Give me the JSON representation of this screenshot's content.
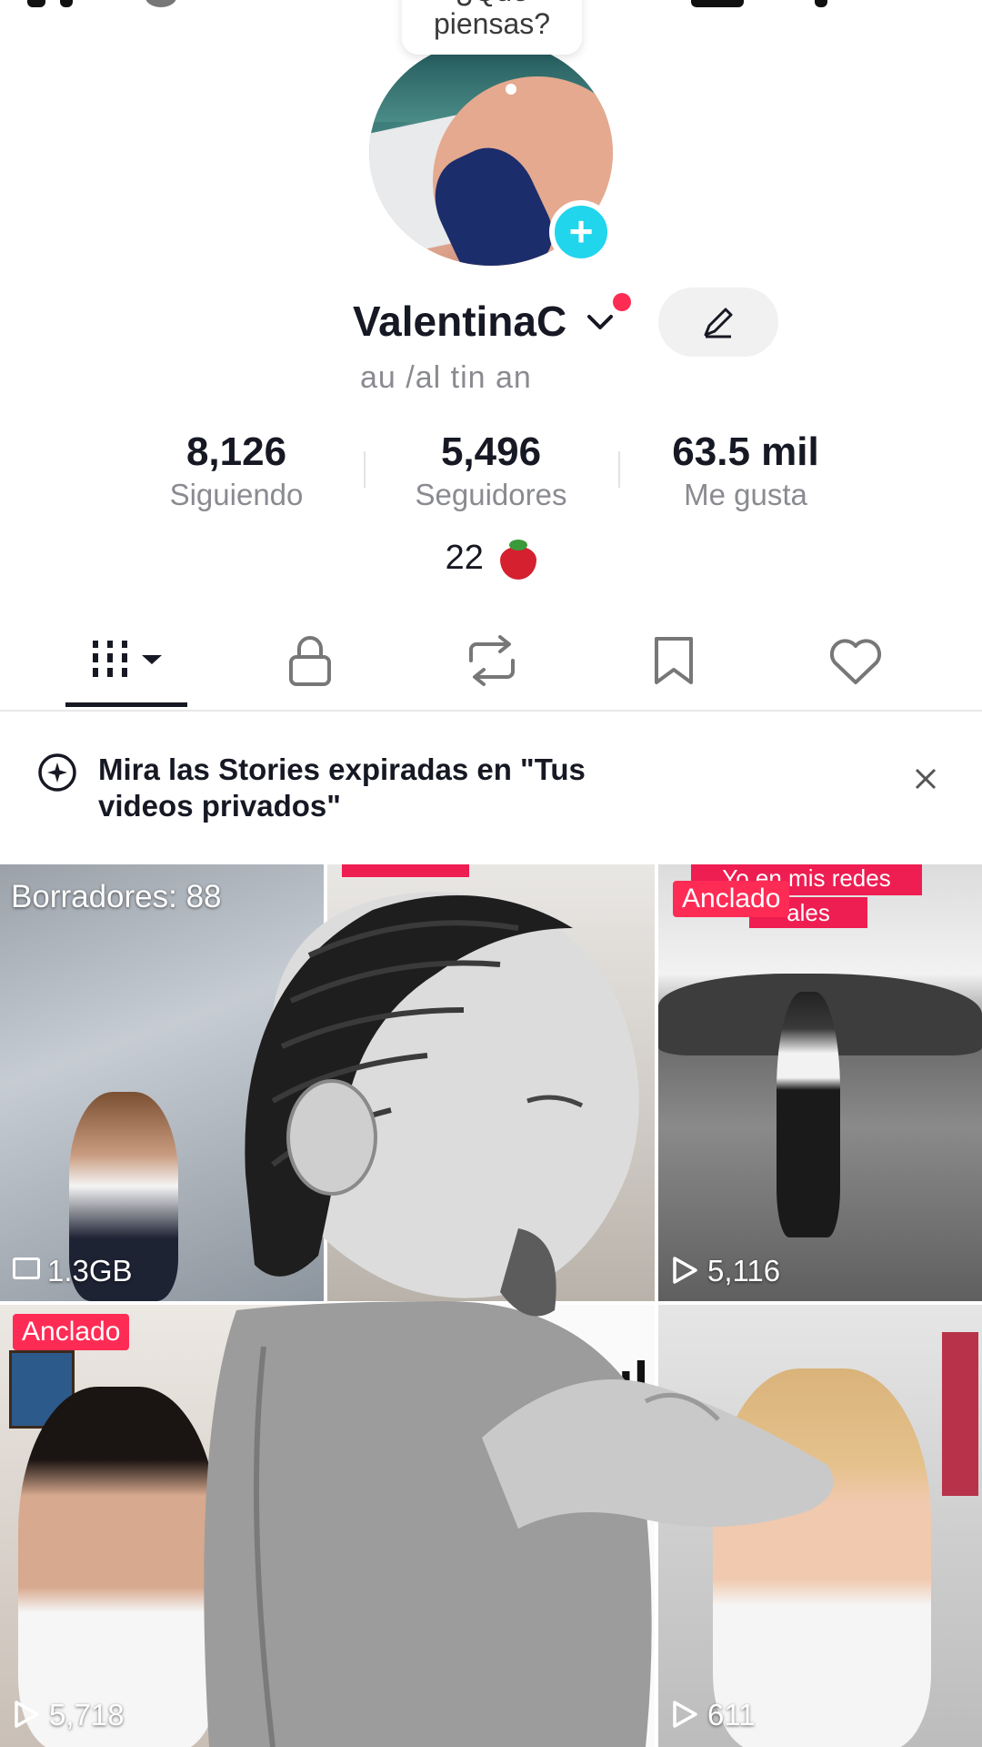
{
  "profile": {
    "thought_bubble": {
      "line1": "¿Qué",
      "line2": "piensas?"
    },
    "username": "ValentinaC",
    "handle": "au   /al    tin   an",
    "add_icon": "plus-icon",
    "edit_icon": "pencil-icon"
  },
  "stats": [
    {
      "value": "8,126",
      "label": "Siguiendo"
    },
    {
      "value": "5,496",
      "label": "Seguidores"
    },
    {
      "value": "63.5 mil",
      "label": "Me gusta"
    }
  ],
  "strawberry_count": "22",
  "tabs": [
    {
      "icon": "grid-icon",
      "active": true
    },
    {
      "icon": "lock-icon"
    },
    {
      "icon": "repost-icon"
    },
    {
      "icon": "bookmark-icon"
    },
    {
      "icon": "heart-icon"
    }
  ],
  "banner": {
    "text": "Mira las Stories expiradas en \"Tus videos privados\"",
    "icon": "story-icon",
    "close_icon": "close-icon"
  },
  "grid": {
    "drafts_label": "Borradores: 88",
    "drafts_size": "1.3GB",
    "pinned_label": "Anclado",
    "cell3_caption_line1": "Yo en mis redes",
    "cell3_caption_line2": "ales",
    "cell3_plays": "5,116",
    "cell4_plays": "5,718",
    "cell6_plays": "611",
    "cell5_partial_text": "ul"
  },
  "colors": {
    "accent_red": "#fe2c55",
    "accent_cyan": "#20d5ec",
    "text_primary": "#161823",
    "text_secondary": "#8a8b91"
  }
}
